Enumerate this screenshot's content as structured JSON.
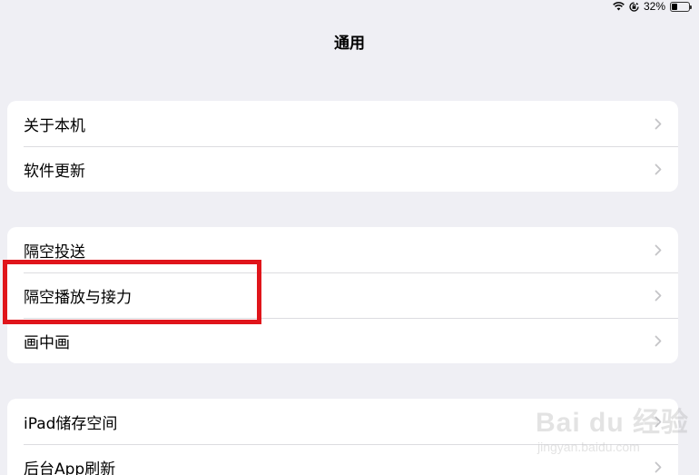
{
  "status_bar": {
    "battery_percent_label": "32%",
    "battery_level": 0.32,
    "icons": [
      "wifi-icon",
      "rotation-lock-icon",
      "battery-icon"
    ]
  },
  "nav": {
    "title": "通用"
  },
  "groups": [
    {
      "rows": [
        {
          "label": "关于本机"
        },
        {
          "label": "软件更新"
        }
      ]
    },
    {
      "rows": [
        {
          "label": "隔空投送"
        },
        {
          "label": "隔空播放与接力"
        },
        {
          "label": "画中画"
        }
      ]
    },
    {
      "rows": [
        {
          "label": "iPad储存空间"
        },
        {
          "label": "后台App刷新"
        }
      ]
    }
  ],
  "annotation": {
    "highlighted_row": "隔空播放与接力",
    "color": "#e0151b"
  },
  "watermark": {
    "main": "Bai du 经验",
    "sub": "jingyan.baidu.com"
  },
  "colors": {
    "background": "#efeff4",
    "chevron": "#c4c4c7"
  }
}
